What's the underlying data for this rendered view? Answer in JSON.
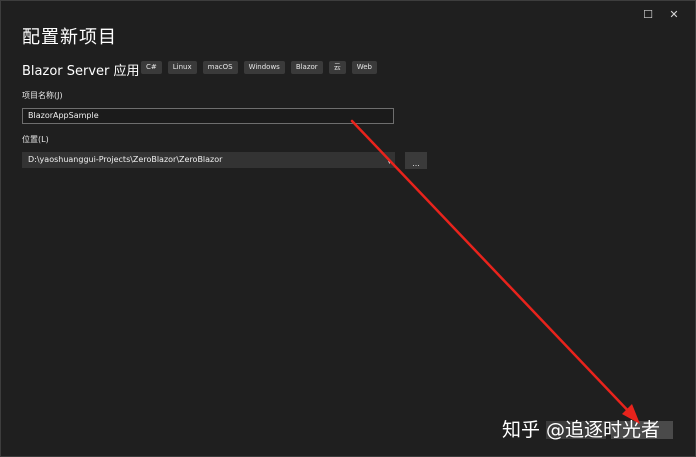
{
  "window": {
    "maximize_icon": "maximize-icon",
    "close_icon": "close-icon",
    "maximize_glyph": "☐",
    "close_glyph": "✕"
  },
  "header": {
    "title": "配置新项目",
    "subtitle": "Blazor Server 应用",
    "tags": [
      "C#",
      "Linux",
      "macOS",
      "Windows",
      "Blazor",
      "云",
      "Web"
    ]
  },
  "form": {
    "project_name_label": "项目名称(J)",
    "project_name_value": "BlazorAppSample",
    "location_label": "位置(L)",
    "location_value": "D:\\yaoshuanggui-Projects\\ZeroBlazor\\ZeroBlazor",
    "browse_label": "...",
    "dropdown_icon": "chevron-down-icon",
    "dropdown_glyph": "▾"
  },
  "overlay": {
    "watermark": "知乎 @追逐时光者",
    "arrow_color": "#e8231c"
  },
  "colors": {
    "background": "#1f1f1f",
    "tag_bg": "#3a3a3a",
    "input_border": "#6e6e6e"
  }
}
